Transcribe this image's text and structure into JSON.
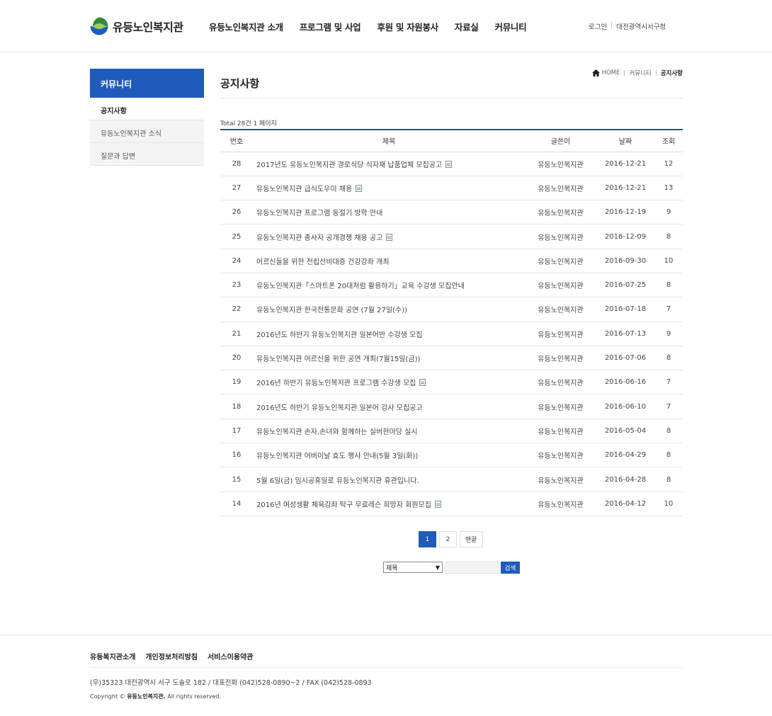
{
  "header": {
    "logo_text": "유등노인복지관",
    "gnb": [
      "유등노인복지관 소개",
      "프로그램 및 사업",
      "후원 및 자원봉사",
      "자료실",
      "커뮤니티"
    ],
    "util_login": "로그인",
    "util_city": "대전광역시서구청"
  },
  "sidebar": {
    "title": "커뮤니티",
    "items": [
      {
        "label": "공지사항"
      },
      {
        "label": "유등노인복지관 소식"
      },
      {
        "label": "질문과 답변"
      }
    ]
  },
  "breadcrumb": {
    "home": "HOME",
    "parent": "커뮤니티",
    "current": "공지사항"
  },
  "page_title": "공지사항",
  "total_text": "Total 28건 1 페이지",
  "board": {
    "headers": {
      "num": "번호",
      "subject": "제목",
      "writer": "글쓴이",
      "date": "날짜",
      "hits": "조회"
    },
    "rows": [
      {
        "num": "28",
        "subject": "2017년도 유등노인복지관 경로식당 식자재 납품업체 모집공고",
        "file": true,
        "writer": "유등노인복지관",
        "date": "2016-12-21",
        "hits": "12"
      },
      {
        "num": "27",
        "subject": "유등노인복지관 급식도우미 채용",
        "file": true,
        "writer": "유등노인복지관",
        "date": "2016-12-21",
        "hits": "13"
      },
      {
        "num": "26",
        "subject": "유등노인복지관 프로그램 동절기 방학 안내",
        "file": false,
        "writer": "유등노인복지관",
        "date": "2016-12-19",
        "hits": "9"
      },
      {
        "num": "25",
        "subject": "유등노인복지관 종사자 공개경쟁 채용 공고",
        "file": true,
        "writer": "유등노인복지관",
        "date": "2016-12-09",
        "hits": "8"
      },
      {
        "num": "24",
        "subject": "어르신들을 위한 전립선비대증 건강강좌 개최",
        "file": false,
        "writer": "유등노인복지관",
        "date": "2016-09-30",
        "hits": "10"
      },
      {
        "num": "23",
        "subject": "유등노인복지관「스마트폰 20대처럼 활용하기」교육 수강생 모집안내",
        "file": false,
        "writer": "유등노인복지관",
        "date": "2016-07-25",
        "hits": "8"
      },
      {
        "num": "22",
        "subject": "유등노인복지관 한국전통문화 공연 (7월 27일(수))",
        "file": false,
        "writer": "유등노인복지관",
        "date": "2016-07-18",
        "hits": "7"
      },
      {
        "num": "21",
        "subject": "2016년도 하반기 유등노인복지관 일본어반 수강생 모집",
        "file": false,
        "writer": "유등노인복지관",
        "date": "2016-07-13",
        "hits": "9"
      },
      {
        "num": "20",
        "subject": "유등노인복지관 어르신을 위한 공연 개최(7월15일(금))",
        "file": false,
        "writer": "유등노인복지관",
        "date": "2016-07-06",
        "hits": "8"
      },
      {
        "num": "19",
        "subject": "2016년 하반기 유등노인복지관 프로그램 수강생 모집",
        "file": true,
        "writer": "유등노인복지관",
        "date": "2016-06-16",
        "hits": "7"
      },
      {
        "num": "18",
        "subject": "2016년도 하반기 유등노인복지관 일본어 강사 모집공고",
        "file": false,
        "writer": "유등노인복지관",
        "date": "2016-06-10",
        "hits": "7"
      },
      {
        "num": "17",
        "subject": "유등노인복지관 손자,손녀와 함께하는 실버한마당 실시",
        "file": false,
        "writer": "유등노인복지관",
        "date": "2016-05-04",
        "hits": "8"
      },
      {
        "num": "16",
        "subject": "유등노인복지관 어버이날 효도 행사 안내(5월 3일(화))",
        "file": false,
        "writer": "유등노인복지관",
        "date": "2016-04-29",
        "hits": "8"
      },
      {
        "num": "15",
        "subject": "5월 6일(금) 임시공휴일로 유등노인복지관 휴관입니다.",
        "file": false,
        "writer": "유등노인복지관",
        "date": "2016-04-28",
        "hits": "8"
      },
      {
        "num": "14",
        "subject": "2016년 여성생활 체육강좌 탁구 무료레슨 희망자 회원모집",
        "file": true,
        "writer": "유등노인복지관",
        "date": "2016-04-12",
        "hits": "10"
      }
    ]
  },
  "paging": {
    "pages": [
      "1",
      "2"
    ],
    "current": "1",
    "last_label": "맨끝"
  },
  "search": {
    "field_selected": "제목",
    "button_label": "검색",
    "keyword_value": ""
  },
  "footer": {
    "links": [
      "유등복지관소개",
      "개인정보처리방침",
      "서비스이용약관"
    ],
    "address": "(우)35323 대전광역시 서구 도솔로 182 / 대표전화 (042)528-0890~2 / FAX (042)528-0893",
    "copyright_prefix": "Copyright ©",
    "copyright_name": "유등노인복지관.",
    "copyright_suffix": "All rights reserved."
  },
  "colors": {
    "primary": "#1f5bba",
    "board_top_border": "#2a4f7c",
    "sidebar_inactive_bg": "#f4f4f4"
  }
}
